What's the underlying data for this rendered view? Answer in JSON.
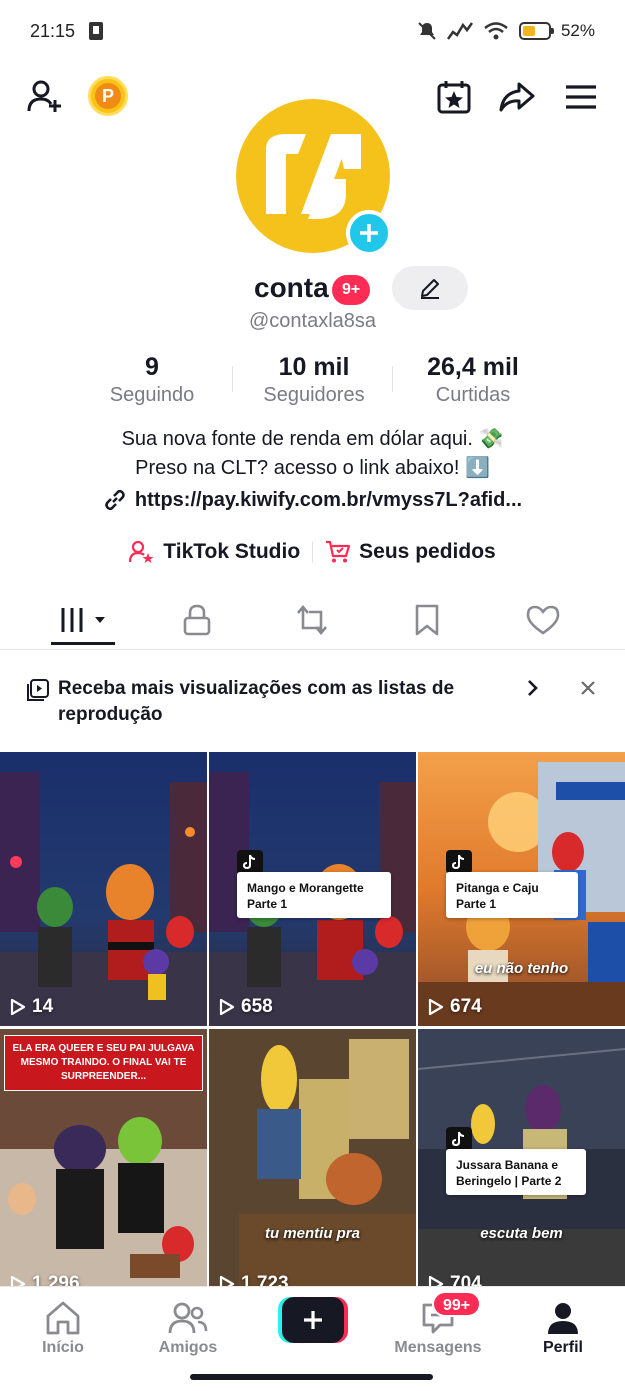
{
  "status_bar": {
    "time": "21:15",
    "battery_percent": "52%",
    "battery_level": 0.52
  },
  "top_bar": {
    "coin_letter": "P",
    "icons": [
      "add-friend-icon",
      "coin-icon",
      "calendar-star-icon",
      "share-icon",
      "menu-icon"
    ]
  },
  "profile": {
    "username": "conta",
    "username_badge": "9+",
    "handle": "@contaxla8sa",
    "stats": [
      {
        "value": "9",
        "label": "Seguindo"
      },
      {
        "value": "10 mil",
        "label": "Seguidores"
      },
      {
        "value": "26,4 mil",
        "label": "Curtidas"
      }
    ],
    "bio_line1": "Sua nova fonte de renda em dólar aqui. 💸",
    "bio_line2": "Preso na CLT? acesso o link abaixo! ⬇️",
    "link": "https://pay.kiwify.com.br/vmyss7L?afid..."
  },
  "quick_links": {
    "studio": "TikTok Studio",
    "orders": "Seus pedidos"
  },
  "banner": {
    "text": "Receba mais visualizações com as listas de reprodução"
  },
  "videos": [
    {
      "views": "14",
      "playlist": "",
      "caption": ""
    },
    {
      "views": "658",
      "playlist": "Mango e Morangette Parte 1",
      "caption": ""
    },
    {
      "views": "674",
      "playlist": "Pitanga e Caju Parte 1",
      "caption": "eu não tenho"
    },
    {
      "views": "1.296",
      "playlist": "",
      "caption": "",
      "banner": "ELA ERA QUEER E SEU PAI JULGAVA MESMO TRAINDO. O FINAL VAI TE SURPREENDER..."
    },
    {
      "views": "1.723",
      "playlist": "",
      "caption": "tu mentiu pra"
    },
    {
      "views": "704",
      "playlist": "Jussara Banana e Beringelo | Parte 2",
      "caption": "escuta bem"
    }
  ],
  "bottom_nav": {
    "home": "Início",
    "friends": "Amigos",
    "inbox": "Mensagens",
    "inbox_badge": "99+",
    "profile": "Perfil"
  }
}
